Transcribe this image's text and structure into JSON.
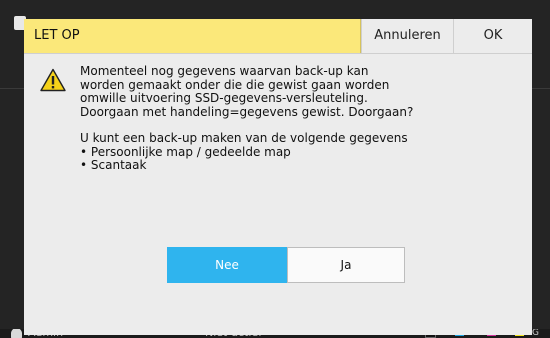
{
  "background": {
    "status_user": "Admin",
    "status_state": "Niet-actief",
    "toner_labels": [
      "K",
      "C",
      "M",
      "Y",
      "G"
    ],
    "toner_colors": [
      "#111111",
      "#1aa3e0",
      "#d0339a",
      "#f3e61f",
      "#999999"
    ]
  },
  "dialog": {
    "title": "LET OP",
    "cancel_label": "Annuleren",
    "ok_label": "OK",
    "warning_icon": "warning-triangle-icon",
    "message_lines": [
      "Momenteel nog gegevens waarvan back-up kan",
      "worden gemaakt onder die die gewist gaan worden",
      "omwille uitvoering SSD-gegevens-versleuteling.",
      "Doorgaan met handeling=gegevens gewist. Doorgaan?"
    ],
    "backup_intro": "U kunt een back-up maken van de volgende gegevens",
    "backup_items": [
      "• Persoonlijke map / gedeelde map",
      "• Scantaak"
    ],
    "no_label": "Nee",
    "yes_label": "Ja"
  },
  "colors": {
    "title_bar": "#fbe87a",
    "primary_button": "#2fb4ee",
    "dialog_bg": "#ececec"
  }
}
